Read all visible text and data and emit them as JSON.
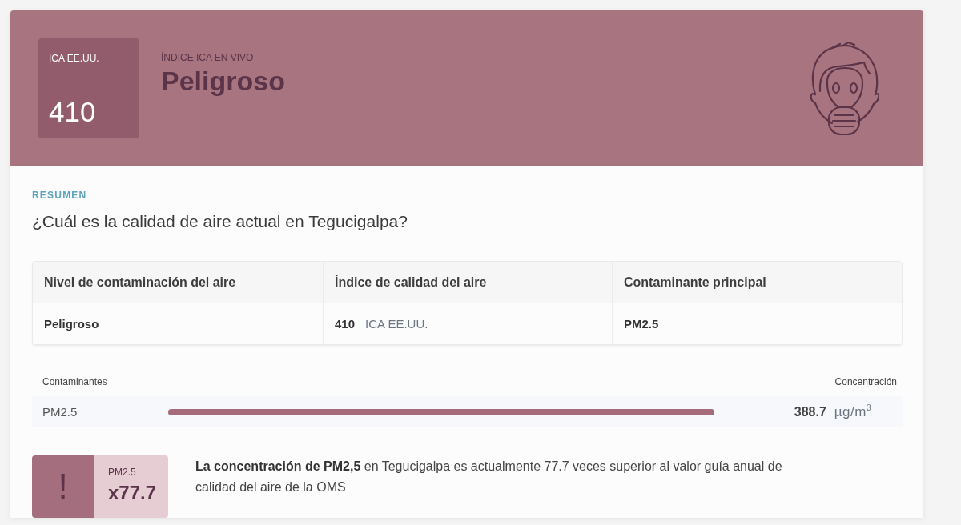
{
  "aqi_header": {
    "badge_label": "ICA EE.UU.",
    "aqi_value": "410",
    "live_label": "ÍNDICE ICA EN VIVO",
    "status": "Peligroso"
  },
  "summary": {
    "eyebrow": "RESUMEN",
    "question": "¿Cuál es la calidad de aire actual en Tegucigalpa?"
  },
  "table": {
    "columns": [
      "Nivel de contaminación del aire",
      "Índice de calidad del aire",
      "Contaminante principal"
    ],
    "rows": [
      {
        "pollution_level": "Peligroso",
        "aqi": "410",
        "aqi_unit": "ICA EE.UU.",
        "main_pollutant": "PM2.5"
      }
    ]
  },
  "pollutants": {
    "label": "Contaminantes",
    "concentration_label": "Concentración",
    "items": [
      {
        "name": "PM2.5",
        "level": 1,
        "value": "388.7",
        "unit": "µg/m$^{3}$"
      }
    ]
  },
  "who_comparison": {
    "alert_symbol": "!",
    "pollutant": "PM2.5",
    "multiplier": "x77.7",
    "text": "**La concentración de PM2,5** en Tegucigalpa es actualmente 77.7 veces superior al valor guía anual de calidad del aire de la OMS"
  }
}
